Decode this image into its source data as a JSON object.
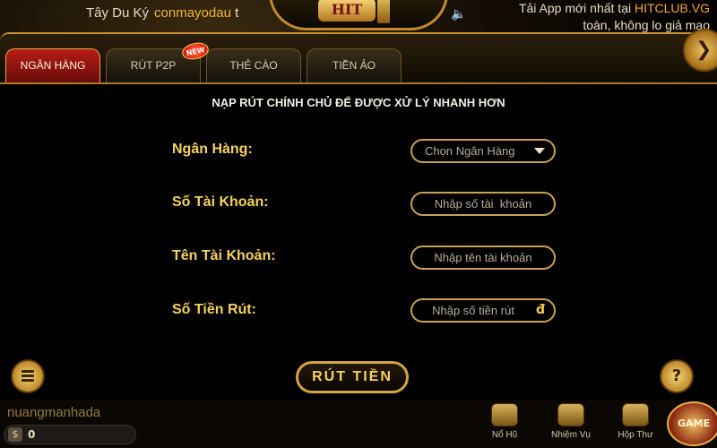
{
  "ticker": {
    "left_prefix": "Tây Du Ký",
    "left_user": "conmayodau",
    "left_suffix": "t",
    "right_line1_prefix": "Tải App mới nhất tại ",
    "right_line1_brand": "HITCLUB.VG",
    "right_line1_suffix": " ",
    "right_line2": "toàn, không lo giả mạo"
  },
  "logo": {
    "text": "HIT"
  },
  "tabs": [
    {
      "label": "NGÂN HÀNG",
      "active": true
    },
    {
      "label": "RÚT P2P",
      "badge": "NEW"
    },
    {
      "label": "THẺ CÀO"
    },
    {
      "label": "TIỀN ẢO"
    }
  ],
  "form": {
    "heading": "NẠP RÚT CHÍNH CHỦ ĐỂ ĐƯỢC XỬ LÝ NHANH HƠN",
    "bank_label": "Ngân Hàng:",
    "bank_select": "Chọn Ngân Hàng",
    "account_number_label": "Số Tài Khoản:",
    "account_number_placeholder": "Nhập số tài  khoản",
    "account_name_label": "Tên Tài Khoản:",
    "account_name_placeholder": "Nhập tên tài khoản",
    "amount_label": "Số Tiền Rút:",
    "amount_placeholder": "Nhập số tiền rút",
    "currency_symbol": "đ",
    "submit_label": "RÚT TIỀN"
  },
  "help": {
    "label": "?"
  },
  "footer": {
    "username": "nuangmanhada",
    "currency_icon": "$",
    "balance": "0",
    "nav": [
      {
        "label": "Nổ Hũ",
        "icon": "jackpot-icon"
      },
      {
        "label": "Nhiệm Vụ",
        "icon": "tasks-icon"
      },
      {
        "label": "Hộp Thư",
        "icon": "mail-icon"
      }
    ],
    "game_button": "GAME"
  },
  "colors": {
    "accent_gold": "#f7d25a",
    "active_tab_red": "#b51d16",
    "border_gold": "#c8a24f"
  }
}
